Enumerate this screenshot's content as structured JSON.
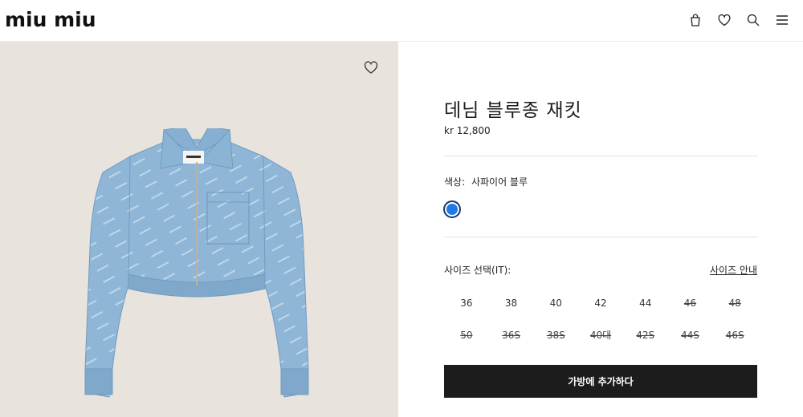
{
  "header": {
    "logo": "miu miu",
    "icons": [
      "bag-icon",
      "heart-icon",
      "search-icon",
      "menu-icon"
    ]
  },
  "product": {
    "title": "데님 블루종 재킷",
    "price": "kr 12,800",
    "color_label": "색상:",
    "color_value": "사파이어 블루",
    "swatch_color": "#1e7ae6",
    "size_label": "사이즈 선택(IT):",
    "size_guide": "사이즈 안내",
    "sizes": [
      {
        "label": "36",
        "available": true
      },
      {
        "label": "38",
        "available": true
      },
      {
        "label": "40",
        "available": true
      },
      {
        "label": "42",
        "available": true
      },
      {
        "label": "44",
        "available": true
      },
      {
        "label": "46",
        "available": false
      },
      {
        "label": "48",
        "available": false
      },
      {
        "label": "50",
        "available": false
      },
      {
        "label": "36S",
        "available": false
      },
      {
        "label": "38S",
        "available": false
      },
      {
        "label": "40대",
        "available": false
      },
      {
        "label": "42S",
        "available": false
      },
      {
        "label": "44S",
        "available": false
      },
      {
        "label": "46S",
        "available": false
      }
    ],
    "add_to_bag": "가방에 추가하다"
  },
  "colors": {
    "image_bg": "#e8e3dc",
    "button_bg": "#1c1c1c",
    "denim": "#8fb6d6"
  }
}
